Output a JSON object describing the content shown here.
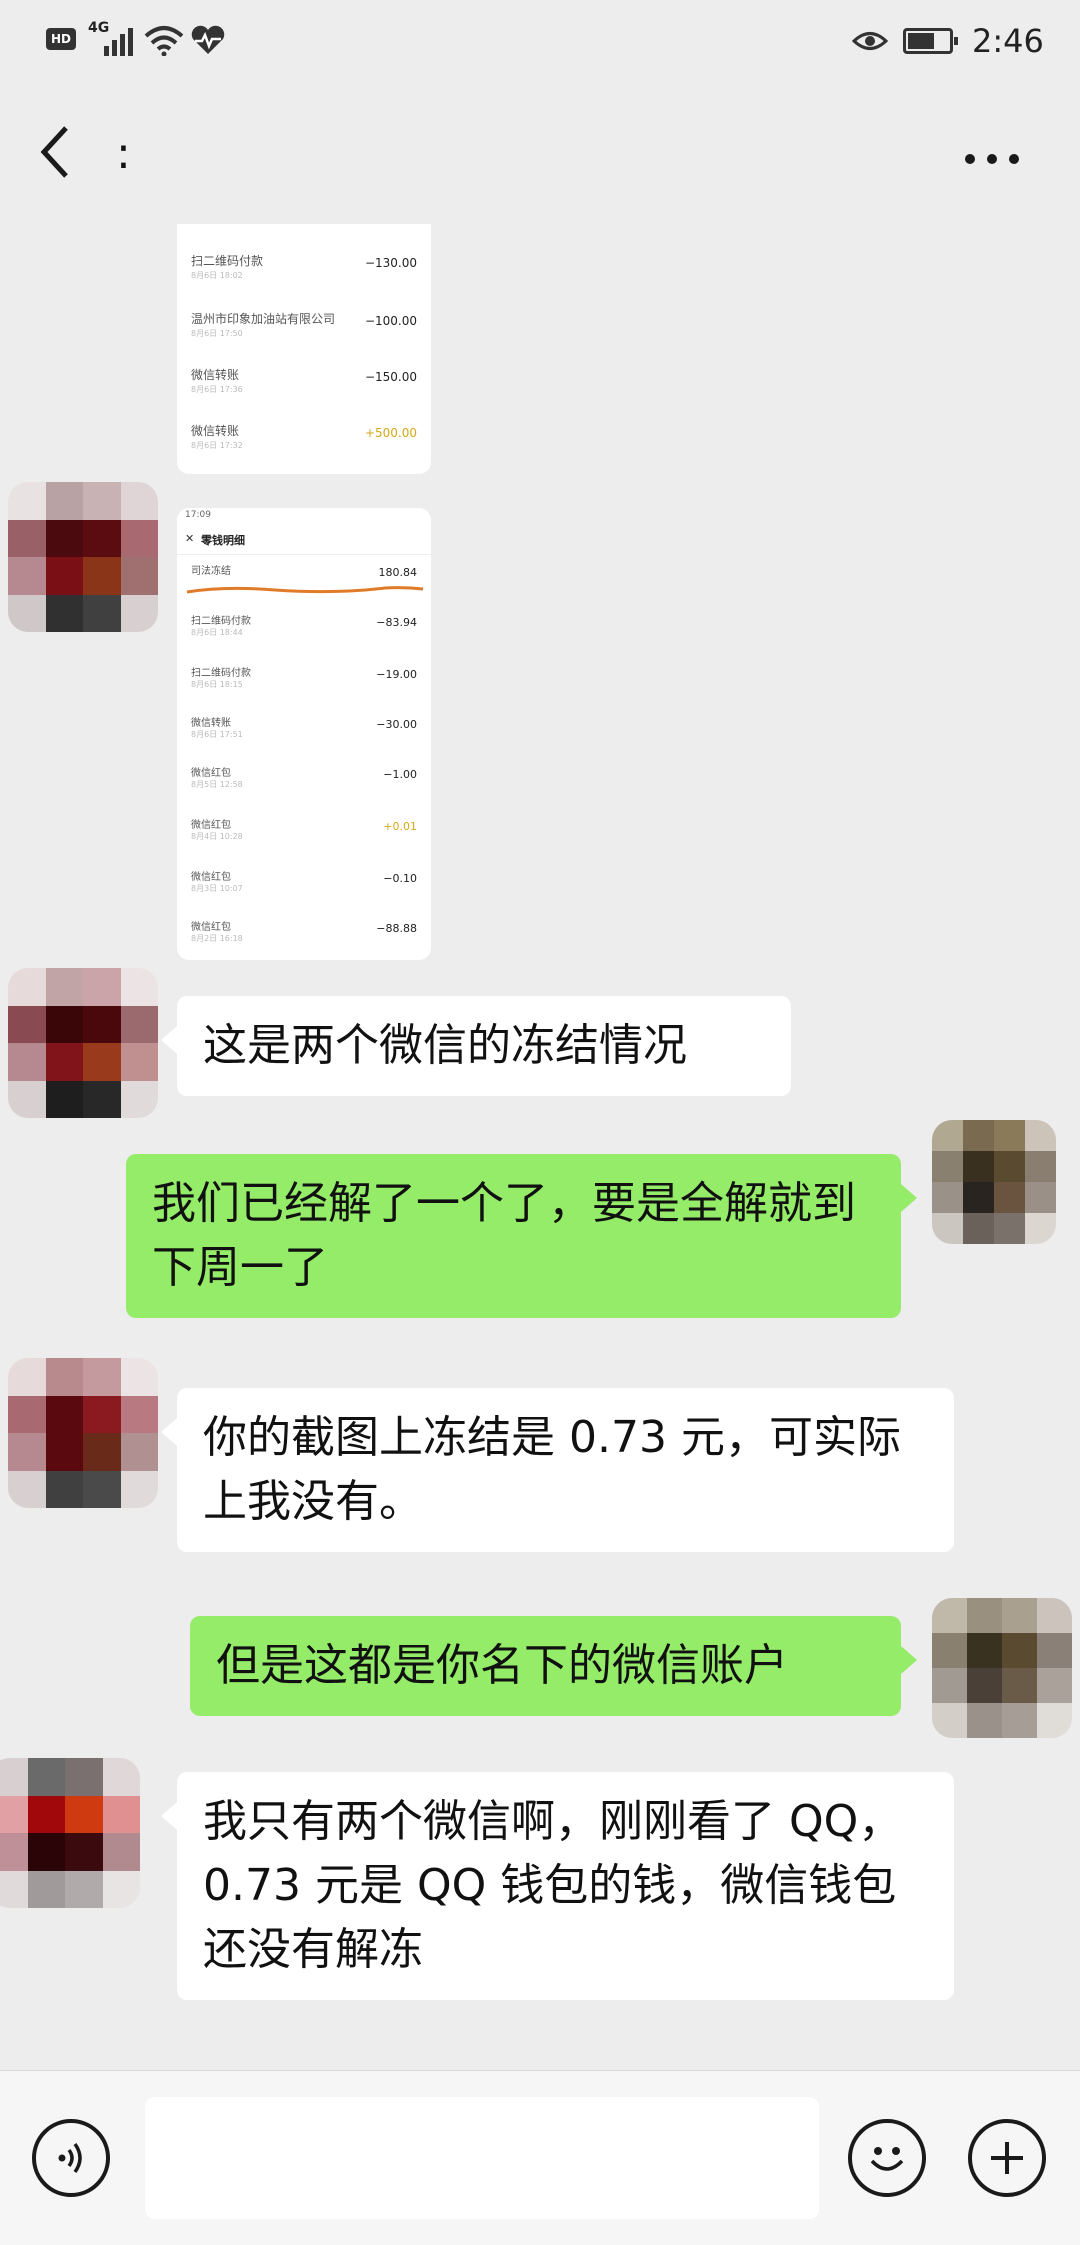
{
  "status_bar": {
    "network_badge": "HD",
    "signal_label": "4G",
    "time": "2:46"
  },
  "header": {
    "title": ":",
    "back_icon": "chevron-left-icon",
    "more_icon": "more-dots-icon"
  },
  "image_message_1": {
    "rows": [
      {
        "name": "扫二维码付款",
        "date": "8月6日 18:02",
        "amount": "−130.00",
        "positive": false
      },
      {
        "name": "温州市印象加油站有限公司",
        "date": "8月6日 17:50",
        "amount": "−100.00",
        "positive": false
      },
      {
        "name": "微信转账",
        "date": "8月6日 17:36",
        "amount": "−150.00",
        "positive": false
      },
      {
        "name": "微信转账",
        "date": "8月6日 17:32",
        "amount": "+500.00",
        "positive": true
      }
    ]
  },
  "image_message_2": {
    "phone_time": "17:09",
    "screen_title": "零钱明细",
    "rows": [
      {
        "name": "司法冻结",
        "date": "",
        "amount": "180.84",
        "positive": false
      },
      {
        "name": "扫二维码付款",
        "date": "8月6日 18:44",
        "amount": "−83.94",
        "positive": false
      },
      {
        "name": "扫二维码付款",
        "date": "8月6日 18:15",
        "amount": "−19.00",
        "positive": false
      },
      {
        "name": "微信转账",
        "date": "8月6日 17:51",
        "amount": "−30.00",
        "positive": false
      },
      {
        "name": "微信红包",
        "date": "8月5日 12:58",
        "amount": "−1.00",
        "positive": false
      },
      {
        "name": "微信红包",
        "date": "8月4日 10:28",
        "amount": "+0.01",
        "positive": true
      },
      {
        "name": "微信红包",
        "date": "8月3日 10:07",
        "amount": "−0.10",
        "positive": false
      },
      {
        "name": "微信红包",
        "date": "8月2日 16:18",
        "amount": "−88.88",
        "positive": false
      }
    ]
  },
  "messages": [
    {
      "side": "left",
      "text": "这是两个微信的冻结情况"
    },
    {
      "side": "right",
      "text": "我们已经解了一个了，要是全解就到下周一了"
    },
    {
      "side": "left",
      "text": "你的截图上冻结是 0.73 元，可实际上我没有。"
    },
    {
      "side": "right",
      "text": "但是这都是你名下的微信账户"
    },
    {
      "side": "left",
      "text": "我只有两个微信啊，刚刚看了 QQ，0.73 元是 QQ 钱包的钱，微信钱包还没有解冻"
    }
  ],
  "input_bar": {
    "placeholder": "",
    "voice_icon": "voice-icon",
    "emoji_icon": "emoji-icon",
    "plus_icon": "plus-icon"
  },
  "colors": {
    "background": "#ededed",
    "sent_bubble": "#95ec69",
    "received_bubble": "#ffffff",
    "positive_amount": "#d4a91a",
    "freeze_underline": "#e07b2a"
  }
}
